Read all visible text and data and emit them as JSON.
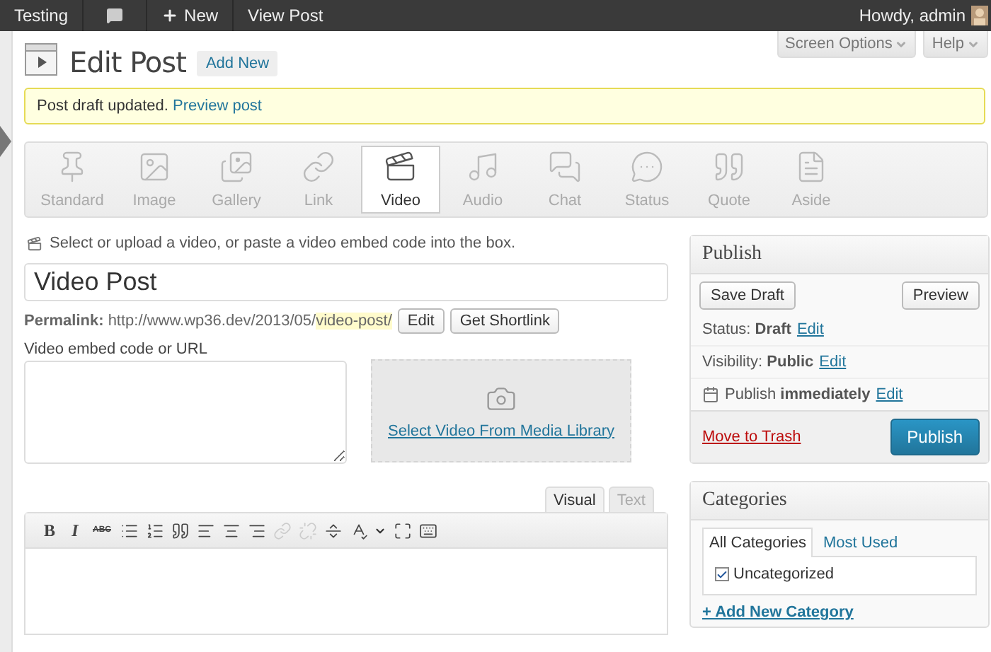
{
  "admin_bar": {
    "site": "Testing",
    "new_label": "New",
    "view_post": "View Post",
    "greeting": "Howdy, admin"
  },
  "header": {
    "title": "Edit Post",
    "add_new": "Add New",
    "screen_options": "Screen Options",
    "help": "Help"
  },
  "notice": {
    "text": "Post draft updated.",
    "link": "Preview post"
  },
  "formats": [
    {
      "kind": "standard",
      "label": "Standard",
      "selected": false
    },
    {
      "kind": "image",
      "label": "Image",
      "selected": false
    },
    {
      "kind": "gallery",
      "label": "Gallery",
      "selected": false
    },
    {
      "kind": "link",
      "label": "Link",
      "selected": false
    },
    {
      "kind": "video",
      "label": "Video",
      "selected": true
    },
    {
      "kind": "audio",
      "label": "Audio",
      "selected": false
    },
    {
      "kind": "chat",
      "label": "Chat",
      "selected": false
    },
    {
      "kind": "status",
      "label": "Status",
      "selected": false
    },
    {
      "kind": "quote",
      "label": "Quote",
      "selected": false
    },
    {
      "kind": "aside",
      "label": "Aside",
      "selected": false
    }
  ],
  "format_hint": "Select or upload a video, or paste a video embed code into the box.",
  "post_title": "Video Post",
  "permalink": {
    "label": "Permalink:",
    "base": "http://www.wp36.dev/2013/05/",
    "slug": "video-post/",
    "edit": "Edit",
    "shortlink": "Get Shortlink"
  },
  "embed": {
    "label": "Video embed code or URL",
    "media_link": "Select Video From Media Library"
  },
  "editor_tabs": [
    {
      "label": "Visual",
      "selected": true
    },
    {
      "label": "Text",
      "selected": false
    }
  ],
  "toolbar": [
    {
      "kind": "bold",
      "label": "B",
      "disabled": false
    },
    {
      "kind": "italic",
      "label": "I",
      "disabled": false
    },
    {
      "kind": "strike",
      "label": "ABC",
      "disabled": false
    },
    {
      "kind": "bullets",
      "disabled": false
    },
    {
      "kind": "numbers",
      "disabled": false
    },
    {
      "kind": "quote",
      "disabled": false
    },
    {
      "kind": "align_left",
      "disabled": false
    },
    {
      "kind": "align_center",
      "disabled": false
    },
    {
      "kind": "align_right",
      "disabled": false
    },
    {
      "kind": "link",
      "disabled": true
    },
    {
      "kind": "unlink",
      "disabled": true
    },
    {
      "kind": "more",
      "disabled": false
    },
    {
      "kind": "spell",
      "disabled": false
    },
    {
      "kind": "fullscreen",
      "disabled": false
    },
    {
      "kind": "kitchen_sink",
      "disabled": false
    }
  ],
  "publish": {
    "title": "Publish",
    "save_draft": "Save Draft",
    "preview": "Preview",
    "rows": [
      {
        "kind": "status",
        "text": "Status: **Draft**",
        "edit": "Edit"
      },
      {
        "kind": "visibility",
        "text": "Visibility: **Public**",
        "edit": "Edit"
      },
      {
        "kind": "schedule",
        "text": "Publish **immediately**",
        "edit": "Edit"
      }
    ],
    "trash": "Move to Trash",
    "publish_button": "Publish"
  },
  "categories": {
    "title": "Categories",
    "tabs": [
      {
        "label": "All Categories",
        "selected": true
      },
      {
        "label": "Most Used",
        "selected": false
      }
    ],
    "items": [
      {
        "label": "Uncategorized",
        "checked": true
      }
    ],
    "add_new": "+ Add New Category"
  }
}
